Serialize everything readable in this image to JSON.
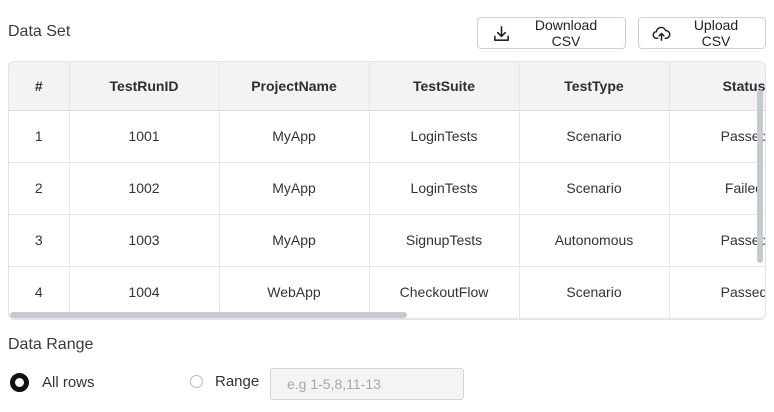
{
  "dataset": {
    "title": "Data Set",
    "download_label": "Download CSV",
    "upload_label": "Upload CSV"
  },
  "table": {
    "columns": [
      "#",
      "TestRunID",
      "ProjectName",
      "TestSuite",
      "TestType",
      "Status"
    ],
    "rows": [
      [
        "1",
        "1001",
        "MyApp",
        "LoginTests",
        "Scenario",
        "Passed"
      ],
      [
        "2",
        "1002",
        "MyApp",
        "LoginTests",
        "Scenario",
        "Failed"
      ],
      [
        "3",
        "1003",
        "MyApp",
        "SignupTests",
        "Autonomous",
        "Passed"
      ],
      [
        "4",
        "1004",
        "WebApp",
        "CheckoutFlow",
        "Scenario",
        "Passed"
      ]
    ]
  },
  "range": {
    "title": "Data Range",
    "all_rows_label": "All rows",
    "range_label": "Range",
    "range_placeholder": "e.g 1-5,8,11-13",
    "selected": "all_rows"
  }
}
